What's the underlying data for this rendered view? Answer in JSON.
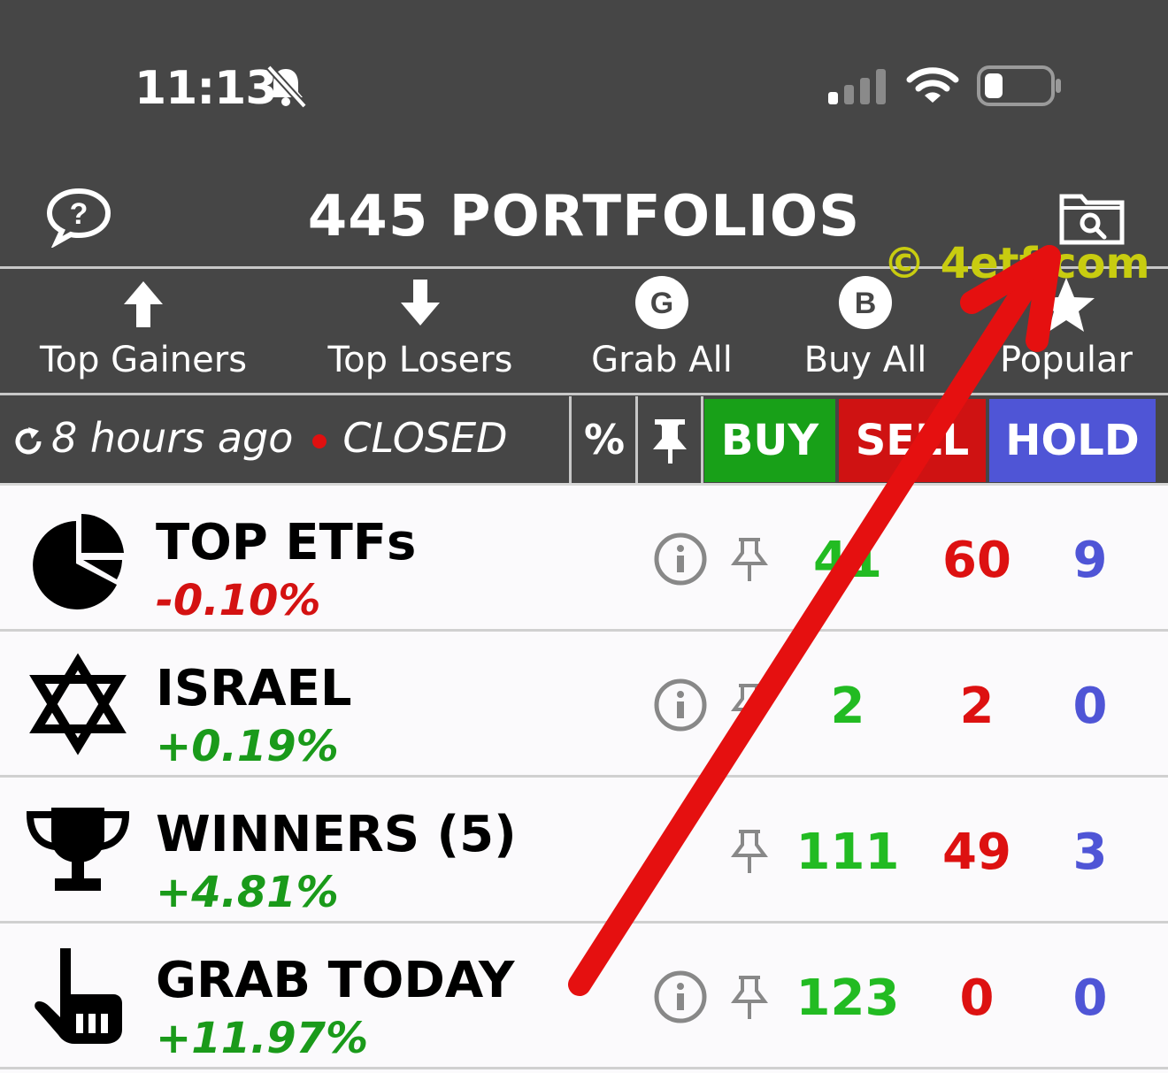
{
  "status_bar": {
    "time": "11:13"
  },
  "header": {
    "title": "445 PORTFOLIOS"
  },
  "toolbar": [
    {
      "label": "Top Gainers",
      "icon": "arrow-up-icon"
    },
    {
      "label": "Top Losers",
      "icon": "arrow-down-icon"
    },
    {
      "label": "Grab All",
      "icon": "g-circle-icon",
      "glyph": "G"
    },
    {
      "label": "Buy All",
      "icon": "b-circle-icon",
      "glyph": "B"
    },
    {
      "label": "Popular",
      "icon": "star-icon"
    }
  ],
  "filter_bar": {
    "updated": "8 hours ago",
    "market_status": "CLOSED",
    "percent_glyph": "%",
    "buy": "BUY",
    "sell": "SELL",
    "hold": "HOLD"
  },
  "watermark": "© 4etf.com",
  "colors": {
    "header_bg": "#464646",
    "buy": "#18a018",
    "sell": "#cf1212",
    "hold": "#4f55d6",
    "positive": "#1a9a1a",
    "negative": "#d41212",
    "annotation_arrow": "#e51010",
    "watermark": "#c8cc10"
  },
  "portfolios": [
    {
      "name": "TOP ETFs",
      "change": "-0.10%",
      "icon": "pie-chart-icon",
      "buy": "41",
      "sell": "60",
      "hold": "9",
      "has_info": true
    },
    {
      "name": "ISRAEL",
      "change": "+0.19%",
      "icon": "star-of-david-icon",
      "buy": "2",
      "sell": "2",
      "hold": "0",
      "has_info": true
    },
    {
      "name": "WINNERS (5)",
      "change": "+4.81%",
      "icon": "trophy-icon",
      "buy": "111",
      "sell": "49",
      "hold": "3",
      "has_info": false
    },
    {
      "name": "GRAB TODAY",
      "change": "+11.97%",
      "icon": "pointing-hand-icon",
      "buy": "123",
      "sell": "0",
      "hold": "0",
      "has_info": true
    }
  ]
}
